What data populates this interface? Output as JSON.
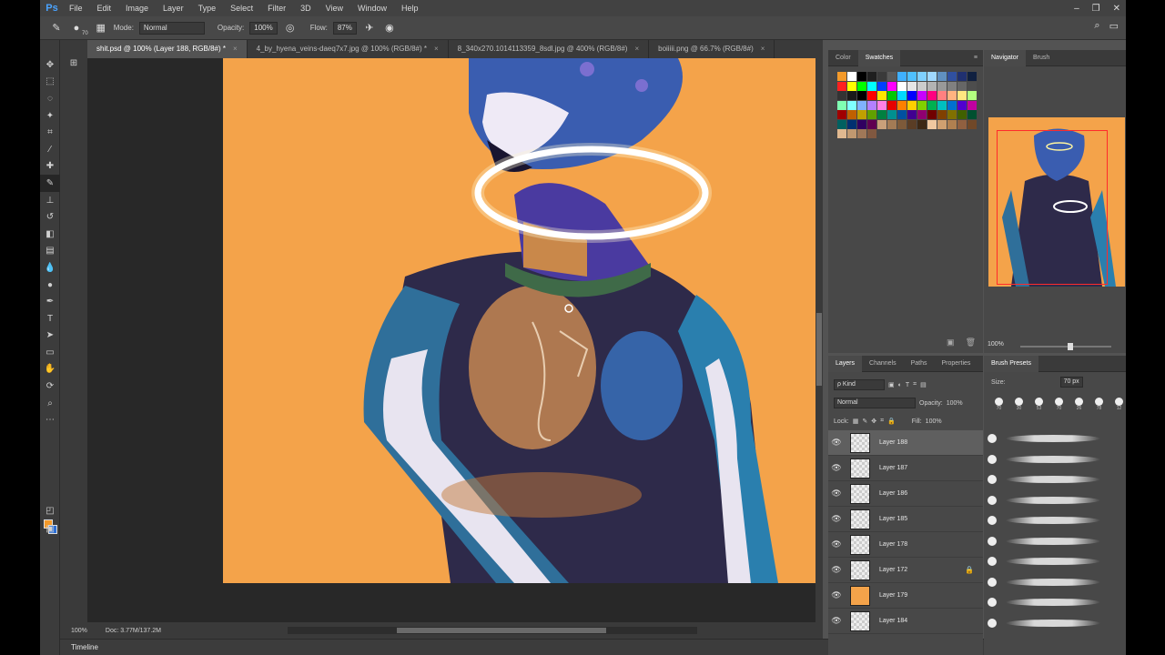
{
  "app": {
    "logo": "Ps"
  },
  "menu": [
    "File",
    "Edit",
    "Image",
    "Layer",
    "Type",
    "Select",
    "Filter",
    "3D",
    "View",
    "Window",
    "Help"
  ],
  "window_controls": [
    "–",
    "❐",
    "✕"
  ],
  "options": {
    "brush_size": "70",
    "mode_label": "Mode:",
    "mode_value": "Normal",
    "opacity_label": "Opacity:",
    "opacity_value": "100%",
    "flow_label": "Flow:",
    "flow_value": "87%"
  },
  "doc_tabs": [
    {
      "label": "shit.psd @ 100% (Layer 188, RGB/8#) *",
      "active": true
    },
    {
      "label": "4_by_hyena_veins-daeq7x7.jpg @ 100% (RGB/8#) *",
      "active": false
    },
    {
      "label": "8_340x270.1014113359_8sdl.jpg @ 400% (RGB/8#)",
      "active": false
    },
    {
      "label": "boiiiii.png @ 66.7% (RGB/8#)",
      "active": false
    }
  ],
  "status": {
    "zoom": "100%",
    "doc": "Doc: 3.77M/137.2M"
  },
  "timeline_label": "Timeline",
  "swatches_panel": {
    "tabs": [
      "Color",
      "Swatches"
    ],
    "active_tab": "Swatches",
    "colors": [
      "#f49a2a",
      "#ffffff",
      "#000000",
      "#1f1f1f",
      "#3a3a3a",
      "#5a5a5a",
      "#3fb0ff",
      "#4fc0ff",
      "#7fd0ff",
      "#a0d8ff",
      "#6090c0",
      "#3050a0",
      "#203070",
      "#102040",
      "#ff2020",
      "#ffff00",
      "#00ff00",
      "#00ffff",
      "#0040ff",
      "#ff00ff",
      "#ffffff",
      "#e6e6e6",
      "#cccccc",
      "#b3b3b3",
      "#999999",
      "#808080",
      "#666666",
      "#4d4d4d",
      "#333333",
      "#1a1a1a",
      "#000000",
      "#ff0000",
      "#ffe600",
      "#00c800",
      "#00d8ff",
      "#0000ff",
      "#c800ff",
      "#ff0080",
      "#ff8080",
      "#ffb380",
      "#ffe680",
      "#b3ff80",
      "#80ffb3",
      "#80ffff",
      "#80b3ff",
      "#b380ff",
      "#ff80e6",
      "#e60000",
      "#ff8000",
      "#ffd000",
      "#80d000",
      "#00b050",
      "#00c0c0",
      "#0070d0",
      "#5000d0",
      "#c000a0",
      "#a00000",
      "#c06000",
      "#c0a000",
      "#60a000",
      "#008040",
      "#009090",
      "#0050a0",
      "#400090",
      "#900070",
      "#700000",
      "#804000",
      "#807000",
      "#406000",
      "#005030",
      "#006060",
      "#003070",
      "#300060",
      "#600050",
      "#c9a07a",
      "#a37b55",
      "#7d5a3a",
      "#5a3d25",
      "#3d2815",
      "#f0c8a0",
      "#d0a070",
      "#b08050",
      "#906040",
      "#704828",
      "#e0b890",
      "#c09870",
      "#a07858",
      "#805840"
    ]
  },
  "navigator_panel": {
    "tabs": [
      "Navigator",
      "Brush"
    ],
    "active_tab": "Navigator",
    "zoom": "100%"
  },
  "layers_panel": {
    "tabs": [
      "Layers",
      "Channels",
      "Paths",
      "Properties"
    ],
    "active_tab": "Layers",
    "kind_label": "ρ Kind",
    "blend_mode": "Normal",
    "opacity_label": "Opacity:",
    "opacity_value": "100%",
    "lock_label": "Lock:",
    "fill_label": "Fill:",
    "fill_value": "100%",
    "layers": [
      {
        "name": "Layer 188",
        "selected": true,
        "locked": false,
        "thumb": "blank"
      },
      {
        "name": "Layer 187",
        "selected": false,
        "locked": false,
        "thumb": "blank"
      },
      {
        "name": "Layer 186",
        "selected": false,
        "locked": false,
        "thumb": "blank"
      },
      {
        "name": "Layer 185",
        "selected": false,
        "locked": false,
        "thumb": "blank"
      },
      {
        "name": "Layer 178",
        "selected": false,
        "locked": false,
        "thumb": "blank"
      },
      {
        "name": "Layer 172",
        "selected": false,
        "locked": true,
        "thumb": "blank"
      },
      {
        "name": "Layer 179",
        "selected": false,
        "locked": false,
        "thumb": "orange"
      },
      {
        "name": "Layer 184",
        "selected": false,
        "locked": false,
        "thumb": "blank"
      }
    ]
  },
  "brush_presets_panel": {
    "title": "Brush Presets",
    "size_label": "Size:",
    "size_value": "70 px",
    "tips": [
      "70",
      "30",
      "53",
      "70",
      "26",
      "78",
      "12"
    ],
    "stroke_count": 10
  }
}
